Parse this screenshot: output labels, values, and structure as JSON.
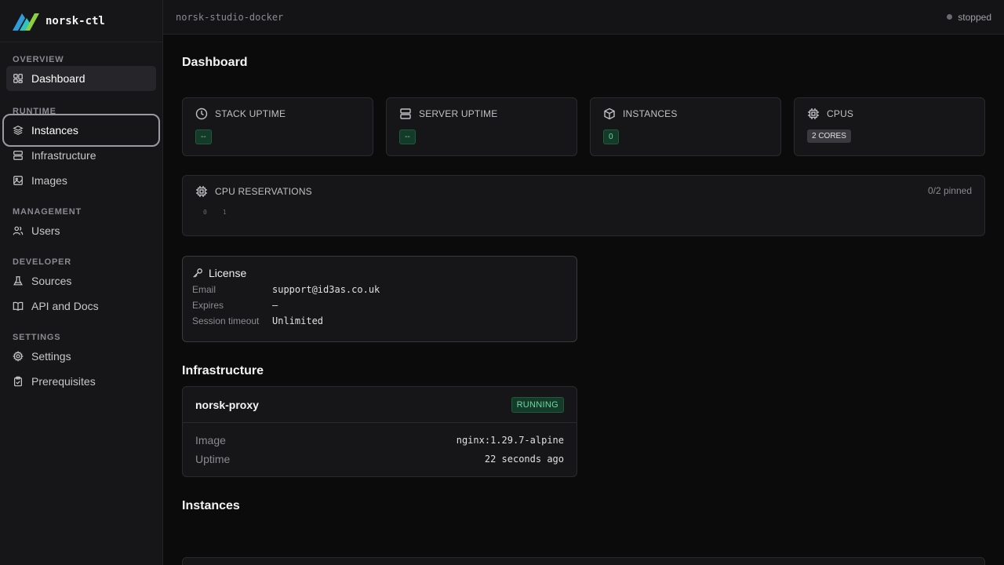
{
  "app": {
    "name": "norsk-ctl"
  },
  "sidebar": {
    "sections": [
      {
        "label": "OVERVIEW",
        "items": [
          {
            "label": "Dashboard",
            "icon": "grid-icon"
          }
        ]
      },
      {
        "label": "RUNTIME",
        "items": [
          {
            "label": "Instances",
            "icon": "layers-icon"
          },
          {
            "label": "Infrastructure",
            "icon": "server-icon"
          },
          {
            "label": "Images",
            "icon": "image-icon"
          }
        ]
      },
      {
        "label": "MANAGEMENT",
        "items": [
          {
            "label": "Users",
            "icon": "users-icon"
          }
        ]
      },
      {
        "label": "DEVELOPER",
        "items": [
          {
            "label": "Sources",
            "icon": "flask-icon"
          },
          {
            "label": "API and Docs",
            "icon": "book-icon"
          }
        ]
      },
      {
        "label": "SETTINGS",
        "items": [
          {
            "label": "Settings",
            "icon": "gear-icon"
          },
          {
            "label": "Prerequisites",
            "icon": "clipboard-icon"
          }
        ]
      }
    ]
  },
  "topbar": {
    "project": "norsk-studio-docker",
    "status": "stopped"
  },
  "dashboard": {
    "title": "Dashboard",
    "stats": [
      {
        "label": "STACK UPTIME",
        "value": "--",
        "style": "green",
        "icon": "clock-icon"
      },
      {
        "label": "SERVER UPTIME",
        "value": "--",
        "style": "green",
        "icon": "server-icon"
      },
      {
        "label": "INSTANCES",
        "value": "0",
        "style": "green",
        "icon": "box-icon"
      },
      {
        "label": "CPUS",
        "value": "2 CORES",
        "style": "grey",
        "icon": "cpu-icon"
      }
    ],
    "reservations": {
      "label": "CPU RESERVATIONS",
      "pinned": "0/2 pinned",
      "cores": [
        "0",
        "1"
      ]
    }
  },
  "license": {
    "title": "License",
    "rows": [
      {
        "key": "Email",
        "value": "support@id3as.co.uk"
      },
      {
        "key": "Expires",
        "value": "—"
      },
      {
        "key": "Session timeout",
        "value": "Unlimited"
      }
    ]
  },
  "infrastructure": {
    "title": "Infrastructure",
    "card": {
      "name": "norsk-proxy",
      "status": "RUNNING",
      "rows": [
        {
          "key": "Image",
          "value": "nginx:1.29.7-alpine"
        },
        {
          "key": "Uptime",
          "value": "22 seconds ago"
        }
      ]
    }
  },
  "instances": {
    "title": "Instances"
  },
  "colors": {
    "accent_green": "#6fd6a0",
    "logo_blue": "#2f9bd8",
    "logo_green": "#8ccf3f"
  }
}
